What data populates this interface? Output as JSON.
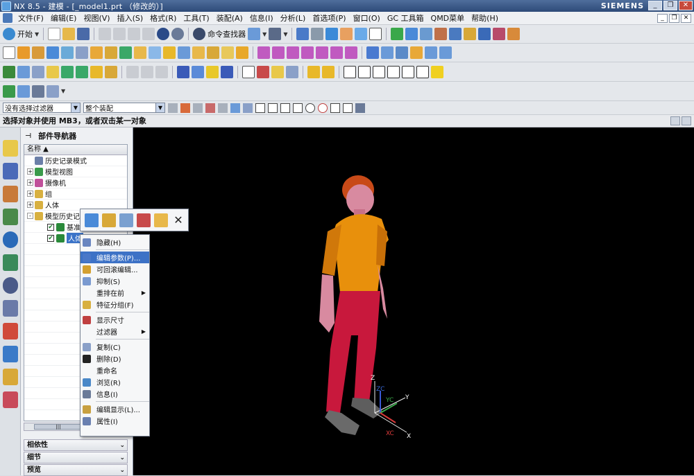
{
  "window": {
    "title": "NX 8.5 - 建模 - [_model1.prt （修改的）]",
    "brand": "SIEMENS"
  },
  "menu": [
    "文件(F)",
    "编辑(E)",
    "视图(V)",
    "插入(S)",
    "格式(R)",
    "工具(T)",
    "装配(A)",
    "信息(I)",
    "分析(L)",
    "首选项(P)",
    "窗口(O)",
    "GC 工具箱",
    "QMD菜单",
    "帮助(H)"
  ],
  "toolbar1": {
    "start_label": "开始",
    "cmd_finder_label": "命令查找器"
  },
  "selection": {
    "filter": "没有选择过滤器",
    "scope": "整个装配"
  },
  "cue": "选择对象并使用 MB3，或者双击某一对象",
  "navigator": {
    "title": "部件导航器",
    "column": "名称",
    "rows": [
      {
        "label": "历史记录模式",
        "level": 0,
        "expander": "",
        "icon": "#6b7fa8"
      },
      {
        "label": "模型视图",
        "level": 0,
        "expander": "+",
        "icon": "#3a9a4a"
      },
      {
        "label": "摄像机",
        "level": 0,
        "expander": "+",
        "icon": "#c0509a"
      },
      {
        "label": "组",
        "level": 0,
        "expander": "+",
        "icon": "#d8b040"
      },
      {
        "label": "人体",
        "level": 0,
        "expander": "+",
        "icon": "#d8b040"
      },
      {
        "label": "模型历史记",
        "level": 0,
        "expander": "-",
        "icon": "#d8b040"
      },
      {
        "label": "基准坐",
        "level": 1,
        "expander": "",
        "icon": "#2a8a3a"
      },
      {
        "label": "人体",
        "level": 1,
        "expander": "",
        "icon": "#2a8a3a",
        "selected": true
      }
    ],
    "panels": [
      "相依性",
      "细节",
      "预览"
    ],
    "scroll_thumb": "|||"
  },
  "minitoolbar": {
    "close": "✕"
  },
  "context_menu": [
    {
      "label": "隐藏(H)",
      "icon": "#6a86c0"
    },
    {
      "divider": true
    },
    {
      "label": "编辑参数(P)...",
      "icon": "#4a78c8",
      "highlighted": true
    },
    {
      "label": "可回滚编辑...",
      "icon": "#d4a030"
    },
    {
      "label": "抑制(S)",
      "icon": "#7a9ad0"
    },
    {
      "label": "重排在前",
      "icon": "",
      "submenu": true
    },
    {
      "label": "特征分组(F)",
      "icon": "#d8b040"
    },
    {
      "divider": true
    },
    {
      "label": "显示尺寸",
      "icon": "#c04040"
    },
    {
      "label": "过滤器",
      "icon": "",
      "submenu": true
    },
    {
      "divider": true
    },
    {
      "label": "复制(C)",
      "icon": "#8aa0c8"
    },
    {
      "label": "删除(D)",
      "icon": "#222222"
    },
    {
      "label": "重命名",
      "icon": ""
    },
    {
      "label": "浏览(R)",
      "icon": "#4a88c8"
    },
    {
      "label": "信息(I)",
      "icon": "#6a7a98"
    },
    {
      "divider": true
    },
    {
      "label": "编辑显示(L)...",
      "icon": "#c8a040"
    },
    {
      "label": "属性(I)",
      "icon": "#6a80b0"
    }
  ],
  "triad": {
    "zc": "ZC",
    "yc": "YC",
    "xc": "XC",
    "z": "Z",
    "y": "Y",
    "x": "X"
  },
  "colors": {
    "shirt": "#e8900c",
    "pants": "#c8183c",
    "skin": "#d88aa0",
    "hair": "#c84a18",
    "shoes": "#6a6a6a",
    "highlight": "#3d72c6"
  }
}
